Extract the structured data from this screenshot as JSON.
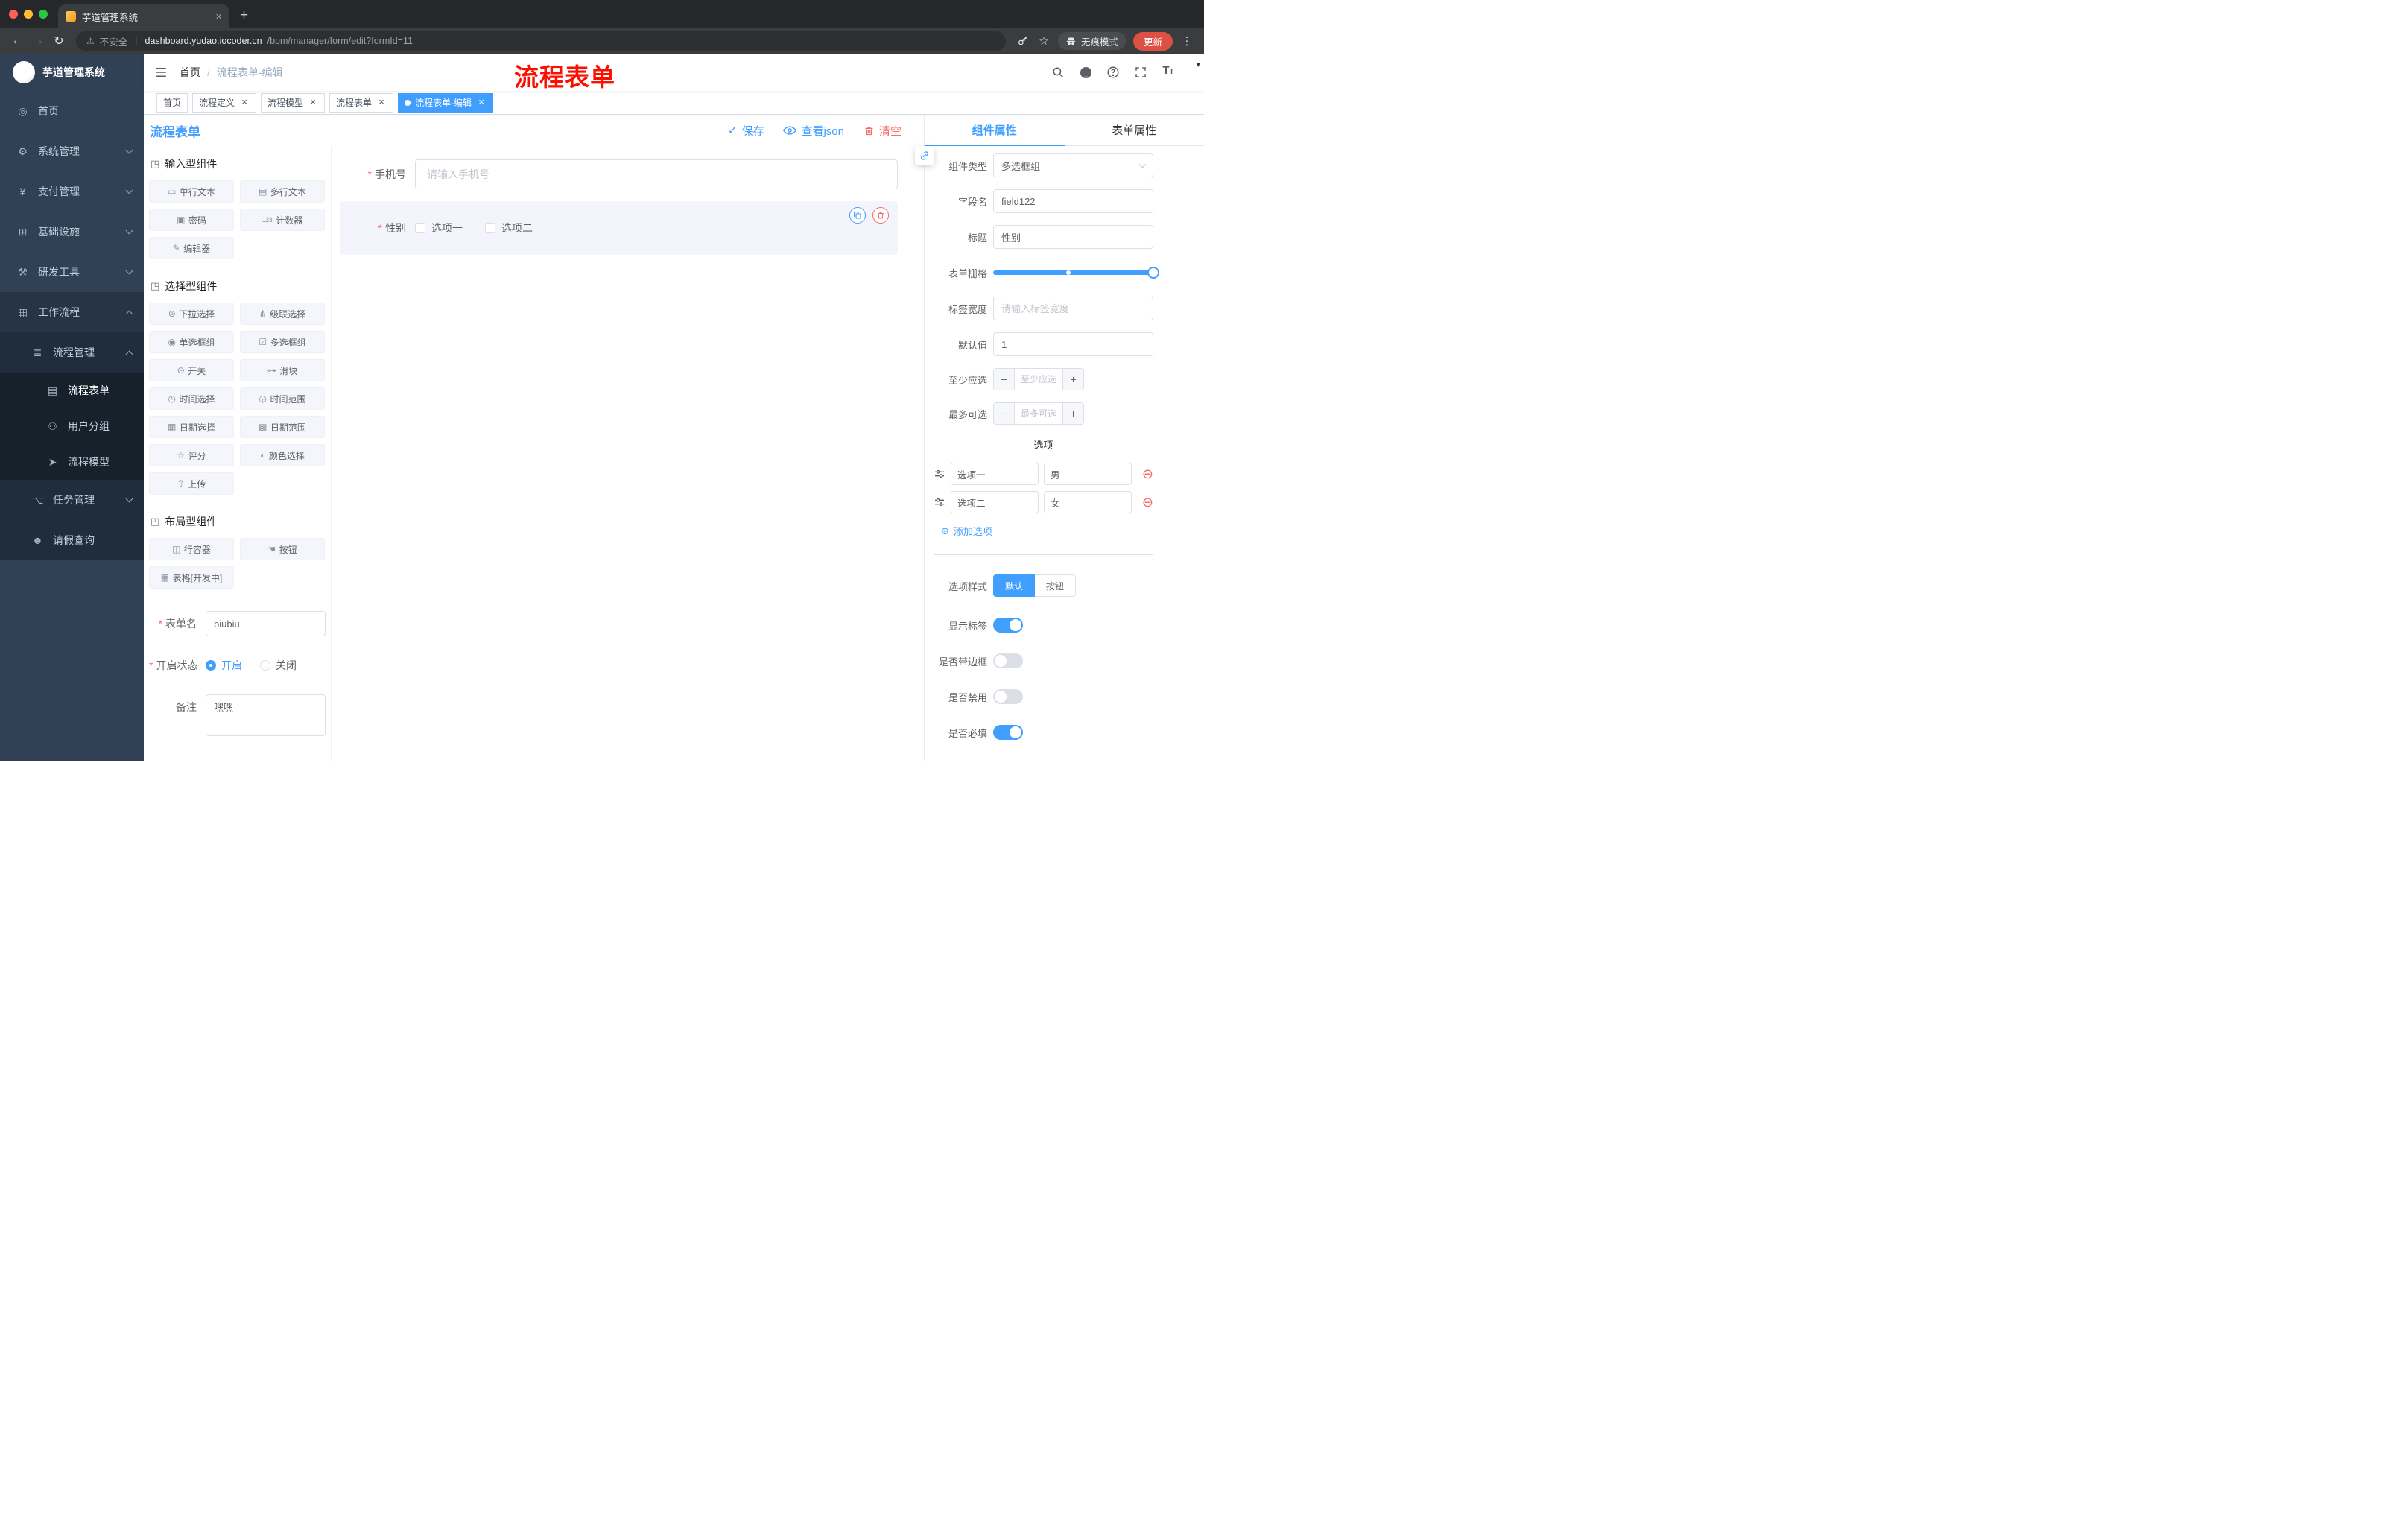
{
  "glyphs": {
    "back": "←",
    "forward": "→",
    "reload": "↻",
    "warning": "⚠",
    "divider": "|",
    "star": "☆",
    "dots": "⋮",
    "tab_close": "×",
    "new_tab": "+",
    "breadcrumb_sep": "/",
    "check": "✓",
    "minus": "−",
    "plus": "+",
    "remove_circle": "⊖",
    "add_circle": "⊕",
    "section": "◳",
    "caret_down": "▾",
    "font_size_big": "T",
    "font_size_small": "T"
  },
  "browser": {
    "tab_title": "芋道管理系统",
    "security_label": "不安全",
    "url_host": "dashboard.yudao.iocoder.cn",
    "url_path": "/bpm/manager/form/edit?formId=11",
    "incognito_label": "无痕模式",
    "update_label": "更新"
  },
  "annotation": "流程表单",
  "sidebar": {
    "logo_title": "芋道管理系统",
    "items": [
      {
        "label": "首页",
        "icon": "◎"
      },
      {
        "label": "系统管理",
        "icon": "⚙"
      },
      {
        "label": "支付管理",
        "icon": "¥"
      },
      {
        "label": "基础设施",
        "icon": "⊞"
      },
      {
        "label": "研发工具",
        "icon": "⚒"
      },
      {
        "label": "工作流程",
        "icon": "▦"
      },
      {
        "label": "流程管理",
        "icon": "≣"
      },
      {
        "label": "流程表单",
        "icon": "▤"
      },
      {
        "label": "用户分组",
        "icon": "⚇"
      },
      {
        "label": "流程模型",
        "icon": "➤"
      },
      {
        "label": "任务管理",
        "icon": "⌥"
      },
      {
        "label": "请假查询",
        "icon": "☻"
      }
    ]
  },
  "header": {
    "breadcrumb": [
      {
        "label": "首页"
      },
      {
        "label": "流程表单-编辑"
      }
    ]
  },
  "tags": [
    {
      "label": "首页"
    },
    {
      "label": "流程定义"
    },
    {
      "label": "流程模型"
    },
    {
      "label": "流程表单"
    },
    {
      "label": "流程表单-编辑"
    }
  ],
  "builder": {
    "title": "流程表单",
    "save": "保存",
    "view_json": "查看json",
    "clear": "清空",
    "sections": [
      {
        "title": "输入型组件",
        "items": [
          {
            "label": "单行文本",
            "icon": "▭"
          },
          {
            "label": "多行文本",
            "icon": "▤"
          },
          {
            "label": "密码",
            "icon": "▣"
          },
          {
            "label": "计数器",
            "icon": "123"
          },
          {
            "label": "编辑器",
            "icon": "✎"
          }
        ]
      },
      {
        "title": "选择型组件",
        "items": [
          {
            "label": "下拉选择",
            "icon": "⊚"
          },
          {
            "label": "级联选择",
            "icon": "⋔"
          },
          {
            "label": "单选框组",
            "icon": "◉"
          },
          {
            "label": "多选框组",
            "icon": "☑"
          },
          {
            "label": "开关",
            "icon": "⊝"
          },
          {
            "label": "滑块",
            "icon": "⊶"
          },
          {
            "label": "时间选择",
            "icon": "◷"
          },
          {
            "label": "时间范围",
            "icon": "◶"
          },
          {
            "label": "日期选择",
            "icon": "▦"
          },
          {
            "label": "日期范围",
            "icon": "▩"
          },
          {
            "label": "评分",
            "icon": "☆"
          },
          {
            "label": "颜色选择",
            "icon": "◐"
          },
          {
            "label": "上传",
            "icon": "⇧"
          }
        ]
      },
      {
        "title": "布局型组件",
        "items": [
          {
            "label": "行容器",
            "icon": "◫"
          },
          {
            "label": "按钮",
            "icon": "☚"
          },
          {
            "label": "表格[开发中]",
            "icon": "▦"
          }
        ]
      }
    ],
    "meta": {
      "form_name_label": "表单名",
      "form_name_value": "biubiu",
      "status_label": "开启状态",
      "status_on": "开启",
      "status_off": "关闭",
      "remark_label": "备注",
      "remark_value": "嘿嘿"
    },
    "canvas": {
      "phone_label": "手机号",
      "phone_placeholder": "请输入手机号",
      "gender_label": "性别",
      "gender_options": [
        {
          "label": "选项一"
        },
        {
          "label": "选项二"
        }
      ]
    }
  },
  "props": {
    "tab_component": "组件属性",
    "tab_form": "表单属性",
    "component_type_label": "组件类型",
    "component_type_value": "多选框组",
    "field_name_label": "字段名",
    "field_name_value": "field122",
    "title_label": "标题",
    "title_value": "性别",
    "grid_label": "表单栅格",
    "label_width_label": "标签宽度",
    "label_width_placeholder": "请输入标签宽度",
    "default_label": "默认值",
    "default_value": "1",
    "min_label": "至少应选",
    "min_placeholder": "至少应选",
    "max_label": "最多可选",
    "max_placeholder": "最多可选",
    "options_divider": "选项",
    "options": [
      {
        "name": "选项一",
        "value": "男"
      },
      {
        "name": "选项二",
        "value": "女"
      }
    ],
    "add_option": "添加选项",
    "style_label": "选项样式",
    "style_default": "默认",
    "style_button": "按钮",
    "show_label": "显示标签",
    "border_label": "是否带边框",
    "disabled_label": "是否禁用",
    "required_label": "是否必填"
  },
  "colors": {
    "accent": "#409eff",
    "danger": "#f56c6c",
    "sidebar_bg": "#304156",
    "tag_active": "#409eff",
    "update_button": "#dd5145",
    "annotation": "#fb0f00"
  }
}
